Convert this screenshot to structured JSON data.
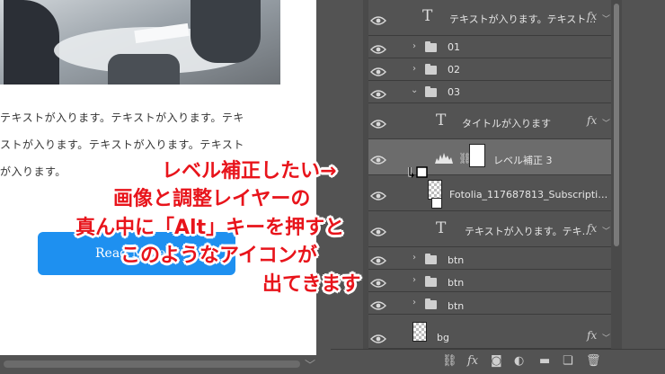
{
  "document": {
    "text_lines": [
      "テキストが入ります。テキストが入ります。テキ",
      "ストが入ります。テキストが入ります。テキスト",
      "が入ります。"
    ],
    "button_label": "Read More"
  },
  "layers": {
    "rows": [
      {
        "type": "text",
        "name": "テキストが入ります。テキスト…",
        "fx": "fx"
      },
      {
        "type": "folder",
        "name": "01"
      },
      {
        "type": "folder",
        "name": "02"
      },
      {
        "type": "folder",
        "name": "03"
      },
      {
        "type": "text",
        "name": "タイトルが入ります",
        "fx": "fx"
      },
      {
        "type": "adjustment",
        "name": "レベル補正 3"
      },
      {
        "type": "smart",
        "name": "Fotolia_117687813_Subscripti…"
      },
      {
        "type": "text",
        "name": "テキストが入ります。テキ…",
        "fx": "fx"
      },
      {
        "type": "folder",
        "name": "btn"
      },
      {
        "type": "folder",
        "name": "btn"
      },
      {
        "type": "folder",
        "name": "btn"
      },
      {
        "type": "image",
        "name": "bg",
        "fx": "fx"
      }
    ],
    "fx_label": "fx"
  },
  "bottom_toolbar": {
    "icons": [
      "link-icon",
      "fx-icon",
      "mask-icon",
      "adjustment-icon",
      "new-group-icon",
      "new-layer-icon",
      "trash-icon"
    ]
  },
  "annotation": {
    "lines": [
      "レベル補正したい→",
      "画像と調整レイヤーの",
      "真ん中に「Alt」キーを押すと",
      "このようなアイコンが",
      "出てきます"
    ],
    "color": "#e8141b"
  }
}
